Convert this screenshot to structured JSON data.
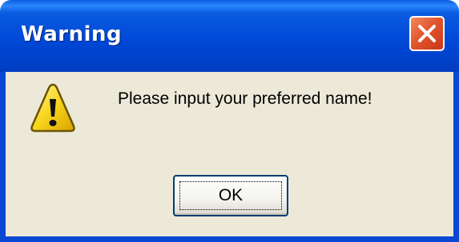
{
  "window": {
    "title": "Warning",
    "close_icon": "close-x-icon",
    "accent_color": "#0a5ce0",
    "close_color": "#e2552c"
  },
  "body": {
    "icon": "warning-triangle-icon",
    "message": "Please input your preferred name!"
  },
  "buttons": {
    "ok_label": "OK"
  }
}
